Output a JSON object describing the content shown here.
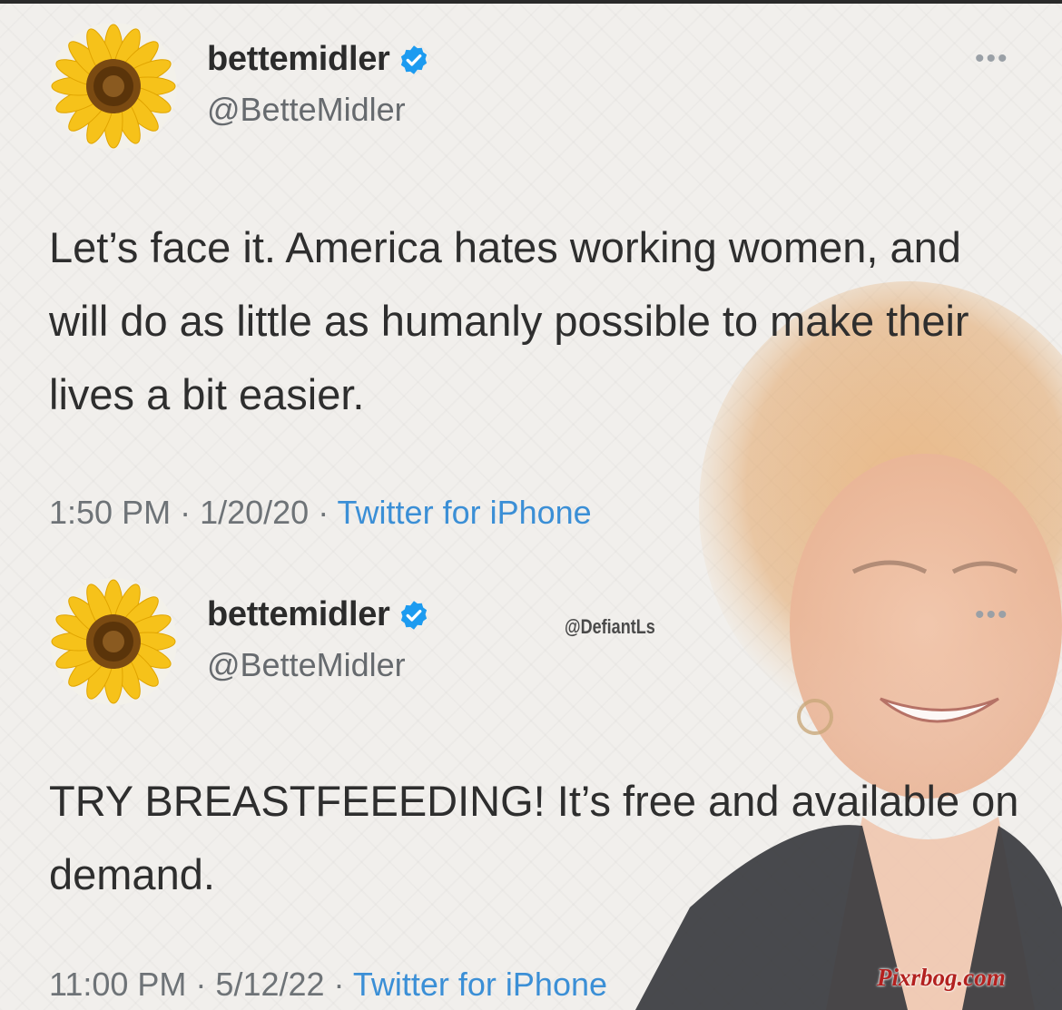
{
  "tweets": [
    {
      "display_name": "bettemidler",
      "handle": "@BetteMidler",
      "text": "Let’s face it.  America hates working women, and will do as little as humanly possible to make their lives a bit easier.",
      "time": "1:50 PM",
      "date": "1/20/20",
      "source": "Twitter for iPhone",
      "more_icon": "•••"
    },
    {
      "display_name": "bettemidler",
      "handle": "@BetteMidler",
      "text": "TRY BREASTFEEEDING!  It’s free and available on demand.",
      "time": "11:00 PM",
      "date": "5/12/22",
      "source": "Twitter for iPhone",
      "more_icon": "•••"
    }
  ],
  "separator": " · ",
  "watermark": "@DefiantLs",
  "site_watermark": "Pixrbog.com",
  "icons": {
    "avatar": "sunflower-icon",
    "verified": "verified-badge-icon",
    "more": "more-options-icon"
  },
  "colors": {
    "verified": "#1d9bf0",
    "source_link": "#3b8fd6",
    "site_watermark": "#b3211f"
  }
}
